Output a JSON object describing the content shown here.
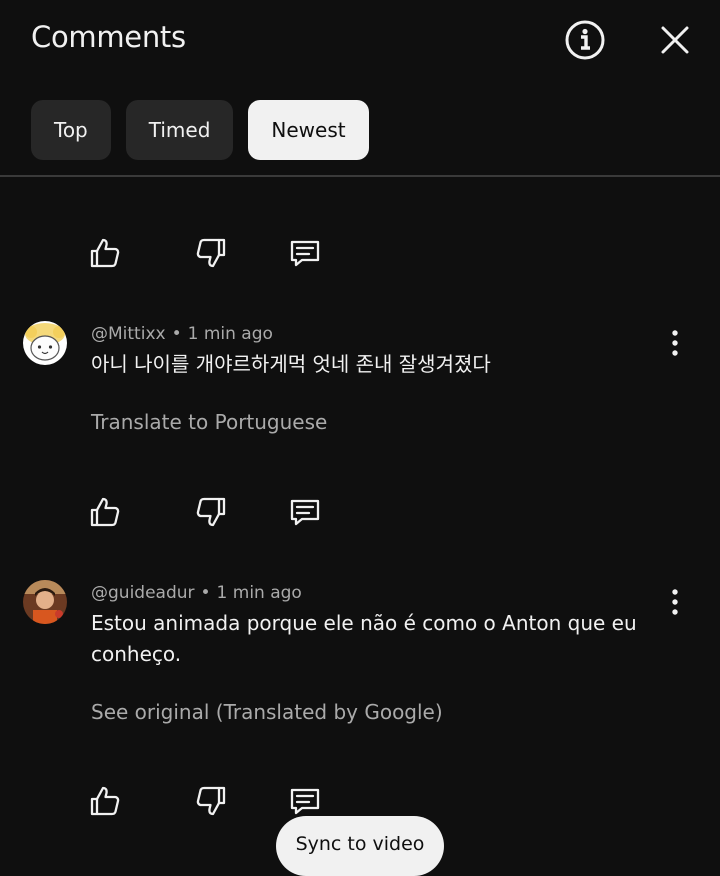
{
  "header": {
    "title": "Comments"
  },
  "chips": [
    {
      "label": "Top"
    },
    {
      "label": "Timed"
    },
    {
      "label": "Newest"
    }
  ],
  "comments": [
    {
      "author": "@Mittixx",
      "time": "1 min ago",
      "text": "아니 나이를 개야르하게먹 엇네 존내 잘생겨졌다",
      "translate_link": "Translate to Portuguese"
    },
    {
      "author": "@guideadur",
      "time": "1 min ago",
      "text": "Estou animada porque ele não é como o Anton que eu conheço.",
      "translate_link": "See original (Translated by Google)"
    }
  ],
  "sync_button": {
    "label": "Sync to video"
  },
  "icons": {
    "info": "info-icon",
    "close": "close-icon",
    "like": "thumbs-up-icon",
    "dislike": "thumbs-down-icon",
    "reply": "reply-icon",
    "more": "more-vert-icon"
  }
}
